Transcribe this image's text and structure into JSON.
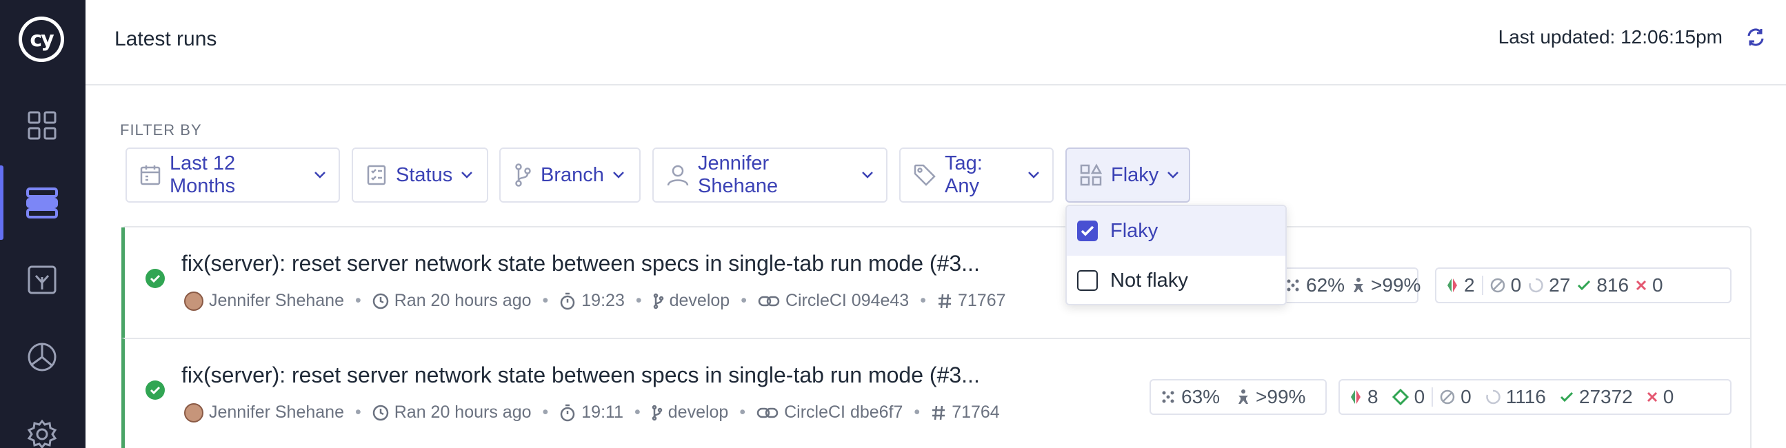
{
  "header": {
    "title": "Latest runs",
    "last_updated": "Last updated: 12:06:15pm"
  },
  "filters": {
    "label": "FILTER BY",
    "items": [
      {
        "label": "Last 12 Months",
        "icon": "calendar-icon"
      },
      {
        "label": "Status",
        "icon": "checklist-icon"
      },
      {
        "label": "Branch",
        "icon": "branch-icon"
      },
      {
        "label": "Jennifer Shehane",
        "icon": "user-icon"
      },
      {
        "label": "Tag: Any",
        "icon": "tag-icon"
      },
      {
        "label": "Flaky",
        "icon": "shapes-icon"
      }
    ],
    "flaky_dropdown": {
      "options": [
        {
          "label": "Flaky",
          "checked": true
        },
        {
          "label": "Not flaky",
          "checked": false
        }
      ]
    }
  },
  "runs": [
    {
      "title": "fix(server): reset server network state between specs in single-tab run mode (#3...",
      "author": "Jennifer Shehane",
      "ran": "Ran 20 hours ago",
      "duration": "19:23",
      "branch": "develop",
      "ci": "CircleCI 094e43",
      "number": "71767",
      "stats": {
        "flaky_rate": "62%",
        "coverage": ">99%",
        "flaky": "2",
        "skipped": "0",
        "pending": "27",
        "passed": "816",
        "failed": "0"
      }
    },
    {
      "title": "fix(server): reset server network state between specs in single-tab run mode (#3...",
      "author": "Jennifer Shehane",
      "ran": "Ran 20 hours ago",
      "duration": "19:11",
      "branch": "develop",
      "ci": "CircleCI dbe6f7",
      "number": "71764",
      "stats": {
        "flaky_rate": "63%",
        "coverage": ">99%",
        "flaky": "8",
        "modified": "0",
        "skipped": "0",
        "pending": "1116",
        "passed": "27372",
        "failed": "0"
      }
    }
  ],
  "colors": {
    "sidebar": "#1b1e2e",
    "accent": "#3b42b5",
    "pass": "#49a466",
    "fail": "#e45770"
  }
}
